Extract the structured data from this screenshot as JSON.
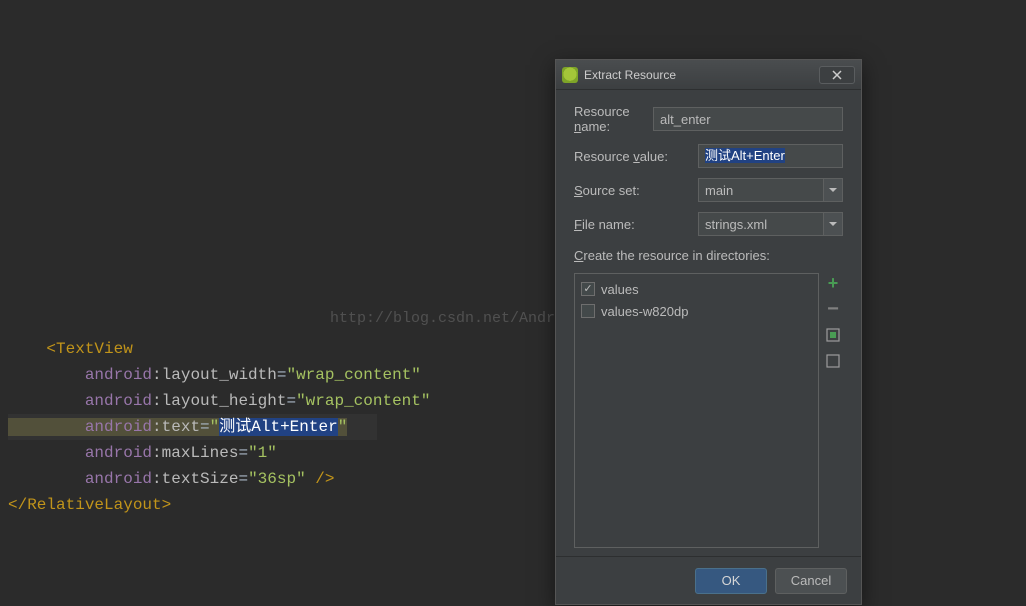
{
  "watermark": "http://blog.csdn.net/Andr",
  "code": {
    "tag_open": "<TextView",
    "attr1_prefix": "android",
    "attr1_name": ":layout_width",
    "attr1_val": "\"wrap_content\"",
    "attr2_prefix": "android",
    "attr2_name": ":layout_height",
    "attr2_val": "\"wrap_content\"",
    "attr3_prefix": "android",
    "attr3_name": ":text",
    "attr3_val_q1": "\"",
    "attr3_val_inner": "测试Alt+Enter",
    "attr3_val_q2": "\"",
    "attr4_prefix": "android",
    "attr4_name": ":maxLines",
    "attr4_val": "\"1\"",
    "attr5_prefix": "android",
    "attr5_name": ":textSize",
    "attr5_val": "\"36sp\"",
    "self_close": " />",
    "tag_close": "</RelativeLayout>"
  },
  "dialog": {
    "title": "Extract Resource",
    "labels": {
      "resource_name_pre": "Resource ",
      "resource_name_u": "n",
      "resource_name_post": "ame:",
      "resource_value_pre": "Resource ",
      "resource_value_u": "v",
      "resource_value_post": "alue:",
      "source_set_u": "S",
      "source_set_post": "ource set:",
      "file_name_u": "F",
      "file_name_post": "ile name:",
      "create_dirs_u": "C",
      "create_dirs_post": "reate the resource in directories:"
    },
    "fields": {
      "resource_name": "alt_enter",
      "resource_value": "测试Alt+Enter",
      "source_set": "main",
      "file_name": "strings.xml"
    },
    "dirs": {
      "item1": "values",
      "item2": "values-w820dp"
    },
    "buttons": {
      "ok": "OK",
      "cancel": "Cancel"
    }
  }
}
